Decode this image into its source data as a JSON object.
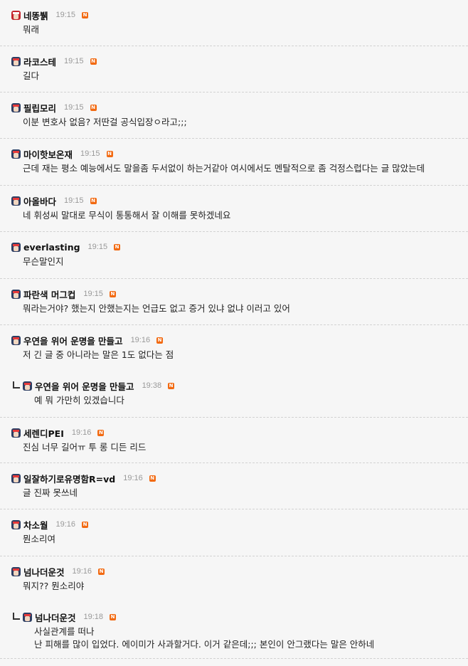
{
  "badge_letter": "N",
  "colors": {
    "badge": "#f26a12",
    "time": "#999999",
    "divider": "#d2d2d2"
  },
  "comments": [
    {
      "nick": "네똥뷁",
      "time": "19:15",
      "text": [
        "뭐래"
      ],
      "reply": false,
      "avatar": "red-face-icon"
    },
    {
      "nick": "라코스테",
      "time": "19:15",
      "text": [
        "길다"
      ],
      "reply": false,
      "avatar": "avatar-icon"
    },
    {
      "nick": "필립모리",
      "time": "19:15",
      "text": [
        "이분 변호사 없음? 저딴걸 공식입장ㅇ라고;;;"
      ],
      "reply": false,
      "avatar": "avatar-icon"
    },
    {
      "nick": "마이핫보온재",
      "time": "19:15",
      "text": [
        "근데 재는 평소 예능에서도 말을좀 두서없이 하는거같아 여시에서도 멘탈적으로 좀 걱정스럽다는 글 많았는데"
      ],
      "reply": false,
      "avatar": "avatar-icon"
    },
    {
      "nick": "아올바다",
      "time": "19:15",
      "text": [
        "네 휘성씨 말대로 무식이 통통해서 잘 이해를 못하겠네요"
      ],
      "reply": false,
      "avatar": "avatar-icon"
    },
    {
      "nick": "everlasting",
      "time": "19:15",
      "text": [
        "무슨말인지"
      ],
      "reply": false,
      "avatar": "avatar-icon"
    },
    {
      "nick": "파란색 머그컵",
      "time": "19:15",
      "text": [
        "뭐라는거야? 했는지 안했는지는 언급도 없고 증거 있냐 없냐 이러고 있어"
      ],
      "reply": false,
      "avatar": "avatar-icon"
    },
    {
      "nick": "우연을 위어 운명을 만들고",
      "time": "19:16",
      "text": [
        "저 긴 글 중 아니라는 말은 1도 없다는 점"
      ],
      "reply": false,
      "avatar": "avatar-icon"
    },
    {
      "nick": "우연을 위어 운명을 만들고",
      "time": "19:38",
      "text": [
        "예 뭐 가만히 있겠습니다"
      ],
      "reply": true,
      "avatar": "avatar-icon"
    },
    {
      "nick": "세렌디PEI",
      "time": "19:16",
      "text": [
        "진심 너무 길어ㅠ 투 롱 디든 리드"
      ],
      "reply": false,
      "avatar": "avatar-icon"
    },
    {
      "nick": "일잘하기로유명함R=vd",
      "time": "19:16",
      "text": [
        "글 진짜 못쓰네"
      ],
      "reply": false,
      "avatar": "avatar-icon"
    },
    {
      "nick": "차소월",
      "time": "19:16",
      "text": [
        "뭔소리여"
      ],
      "reply": false,
      "avatar": "avatar-icon"
    },
    {
      "nick": "넘나더운것",
      "time": "19:16",
      "text": [
        "뭐지?? 뭔소리야"
      ],
      "reply": false,
      "avatar": "avatar-icon"
    },
    {
      "nick": "넘나더운것",
      "time": "19:18",
      "text": [
        "사실관계를 떠나",
        "난 피해를 많이 입었다. 에이미가 사과할거다. 이거 같은데;;; 본인이 안그랬다는 말은 안하네"
      ],
      "reply": true,
      "avatar": "avatar-icon"
    }
  ]
}
